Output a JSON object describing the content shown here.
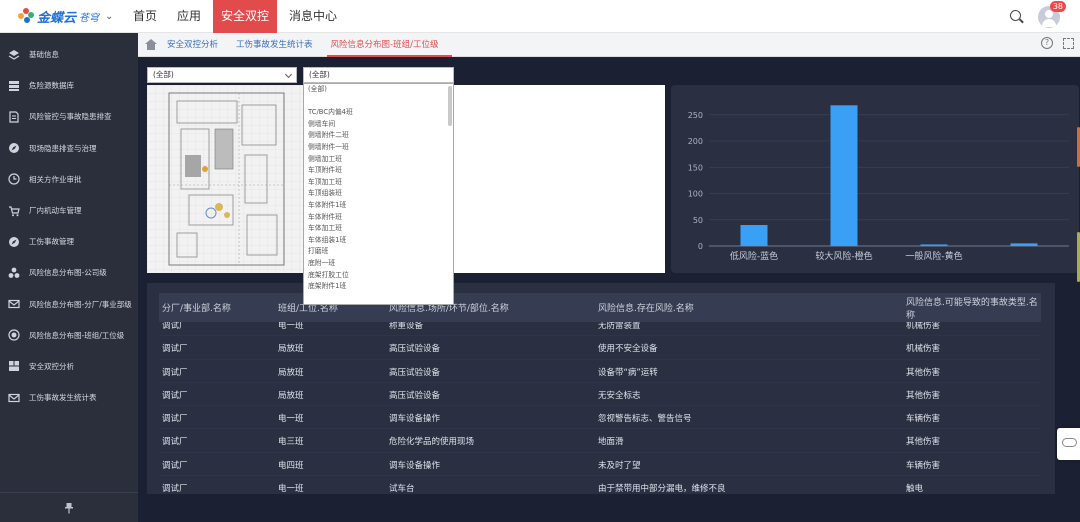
{
  "app": {
    "logo_name": "金蝶云",
    "logo_sub": "苍穹",
    "nav": [
      {
        "label": "首页",
        "active": false
      },
      {
        "label": "应用",
        "active": false
      },
      {
        "label": "安全双控",
        "active": true
      },
      {
        "label": "消息中心",
        "active": false
      }
    ],
    "badge_count": "38"
  },
  "sidebar": {
    "items": [
      {
        "label": "基础信息",
        "icon": "layers-icon"
      },
      {
        "label": "危险源数据库",
        "icon": "database-icon"
      },
      {
        "label": "风险管控与事故隐患排查",
        "icon": "document-icon"
      },
      {
        "label": "现场隐患排查与治理",
        "icon": "compass-icon"
      },
      {
        "label": "相关方作业审批",
        "icon": "clock-icon"
      },
      {
        "label": "厂内机动车管理",
        "icon": "cart-icon"
      },
      {
        "label": "工伤事故管理",
        "icon": "compass-icon"
      },
      {
        "label": "风险信息分布图-公司级",
        "icon": "cluster-icon"
      },
      {
        "label": "风险信息分布图-分厂/事业部级",
        "icon": "mail-icon"
      },
      {
        "label": "风险信息分布图-班组/工位级",
        "icon": "target-icon"
      },
      {
        "label": "安全双控分析",
        "icon": "dashboard-icon"
      },
      {
        "label": "工伤事故发生统计表",
        "icon": "mail-icon"
      }
    ]
  },
  "tabs": [
    {
      "label": "安全双控分析",
      "active": false
    },
    {
      "label": "工伤事故发生统计表",
      "active": false
    },
    {
      "label": "风险信息分布图-班组/工位级",
      "active": true
    }
  ],
  "filters": {
    "select1": "(全部)",
    "select2": "(全部)"
  },
  "dropdown_options": [
    "(全部)",
    "",
    "TC/BC内偏4班",
    "侧墙车间",
    "侧墙附件二班",
    "侧墙附件一班",
    "侧墙加工班",
    "车顶附件班",
    "车顶加工班",
    "车顶组装班",
    "车体附件1班",
    "车体附件班",
    "车体加工班",
    "车体组装1班",
    "打磨班",
    "底附一班",
    "底架打胶工位",
    "底架附件1班"
  ],
  "chart_data": {
    "type": "bar",
    "categories": [
      "低风险-蓝色",
      "较大风险-橙色",
      "一般风险-黄色",
      ""
    ],
    "values": [
      40,
      268,
      3,
      5
    ],
    "ylim": [
      0,
      280
    ],
    "yticks": [
      0,
      50,
      100,
      150,
      200,
      250
    ],
    "bar_color": "#3aa0f5",
    "grid": true
  },
  "table": {
    "headers": [
      "分厂/事业部.名称",
      "班组/工位.名称",
      "风险信息.场所/环节/部位.名称",
      "风险信息.存在风险.名称",
      "风险信息.可能导致的事故类型.名称"
    ],
    "rows": [
      [
        "调试厂",
        "电一班",
        "称重设备",
        "无防雷装置",
        "机械伤害"
      ],
      [
        "调试厂",
        "局放班",
        "高压试验设备",
        "使用不安全设备",
        "机械伤害"
      ],
      [
        "调试厂",
        "局放班",
        "高压试验设备",
        "设备带“病”运转",
        "其他伤害"
      ],
      [
        "调试厂",
        "局放班",
        "高压试验设备",
        "无安全标志",
        "其他伤害"
      ],
      [
        "调试厂",
        "电一班",
        "调车设备操作",
        "忽视警告标志、警告信号",
        "车辆伤害"
      ],
      [
        "调试厂",
        "电三班",
        "危险化学品的使用现场",
        "地面滑",
        "其他伤害"
      ],
      [
        "调试厂",
        "电四班",
        "调车设备操作",
        "未及时了望",
        "车辆伤害"
      ],
      [
        "调试厂",
        "电一班",
        "试车台",
        "由于禁带用中部分漏电，维修不良",
        "触电"
      ]
    ]
  }
}
